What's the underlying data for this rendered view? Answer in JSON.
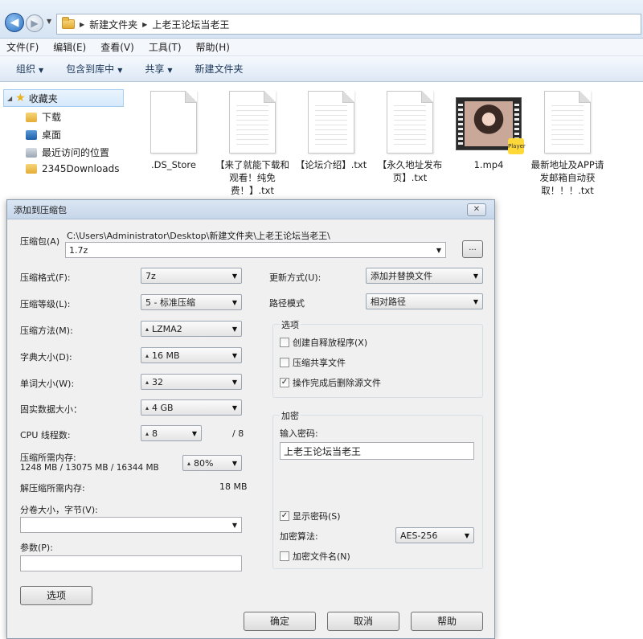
{
  "explorer": {
    "breadcrumb": [
      "新建文件夹",
      "上老王论坛当老王"
    ],
    "menu": [
      "文件(F)",
      "编辑(E)",
      "查看(V)",
      "工具(T)",
      "帮助(H)"
    ],
    "toolbar": {
      "organize": "组织",
      "include_in_library": "包含到库中",
      "share": "共享",
      "new_folder": "新建文件夹"
    },
    "nav": {
      "favorites": "收藏夹",
      "items": [
        "下载",
        "桌面",
        "最近访问的位置",
        "2345Downloads"
      ]
    },
    "files": [
      {
        "name": ".DS_Store",
        "type": "doc"
      },
      {
        "name": "【来了就能下载和观看！纯免费！】.txt",
        "type": "doc"
      },
      {
        "name": "【论坛介绍】.txt",
        "type": "doc"
      },
      {
        "name": "【永久地址发布页】.txt",
        "type": "doc"
      },
      {
        "name": "1.mp4",
        "type": "video"
      },
      {
        "name": "最新地址及APP请发邮箱自动获取！！！.txt",
        "type": "doc"
      }
    ],
    "video_badge": "Player"
  },
  "dialog": {
    "title": "添加到压缩包",
    "close_glyph": "✕",
    "archive_label": "压缩包(A)",
    "archive_path": "C:\\Users\\Administrator\\Desktop\\新建文件夹\\上老王论坛当老王\\",
    "archive_name": "1.7z",
    "browse": "...",
    "format_label": "压缩格式(F):",
    "format_value": "7z",
    "level_label": "压缩等级(L):",
    "level_value": "5 - 标准压缩",
    "method_label": "压缩方法(M):",
    "method_value": "LZMA2",
    "dict_label": "字典大小(D):",
    "dict_value": "16 MB",
    "word_label": "单词大小(W):",
    "word_value": "32",
    "solid_label": "固实数据大小：",
    "solid_value": "4 GB",
    "cpu_label": "CPU 线程数:",
    "cpu_value": "8",
    "cpu_total": "/ 8",
    "mem_label": "压缩所需内存:",
    "mem_detail": "1248 MB / 13075 MB / 16344 MB",
    "mem_percent": "80%",
    "decomp_label": "解压缩所需内存:",
    "decomp_value": "18 MB",
    "volume_label": "分卷大小，字节(V):",
    "volume_value": "",
    "params_label": "参数(P):",
    "params_value": "",
    "options_button": "选项",
    "update_label": "更新方式(U):",
    "update_value": "添加并替换文件",
    "path_label": "路径模式",
    "path_value": "相对路径",
    "options_group": "选项",
    "opt_sfx": "创建自释放程序(X)",
    "opt_shared": "压缩共享文件",
    "opt_delete": "操作完成后删除源文件",
    "encrypt_group": "加密",
    "password_label": "输入密码:",
    "password_value": "上老王论坛当老王",
    "show_password": "显示密码(S)",
    "algo_label": "加密算法:",
    "algo_value": "AES-256",
    "encrypt_names": "加密文件名(N)",
    "ok": "确定",
    "cancel": "取消",
    "help": "帮助",
    "checks": {
      "sfx": false,
      "shared": false,
      "delete": true,
      "show_password": true,
      "encrypt_names": false
    }
  }
}
